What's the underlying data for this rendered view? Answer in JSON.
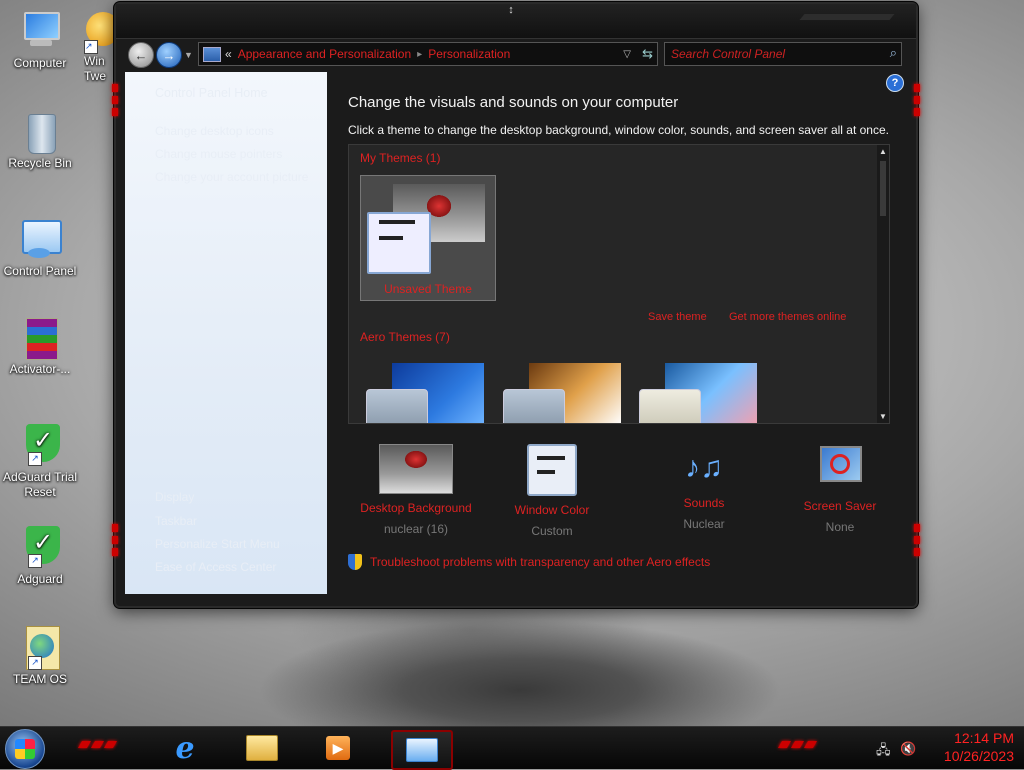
{
  "desktop": {
    "icons": [
      {
        "label": "Computer"
      },
      {
        "label": "Win Twe"
      },
      {
        "label": "Recycle Bin"
      },
      {
        "label": "Control Panel"
      },
      {
        "label": "Activator-..."
      },
      {
        "label": "AdGuard Trial Reset"
      },
      {
        "label": "Adguard"
      },
      {
        "label": "TEAM OS"
      }
    ]
  },
  "window": {
    "address": {
      "breadcrumbs": [
        "Appearance and Personalization",
        "Personalization"
      ],
      "prefix": "«"
    },
    "search": {
      "placeholder": "Search Control Panel"
    },
    "sidebar": {
      "home": "Control Panel Home",
      "links": [
        "Change desktop icons",
        "Change mouse pointers",
        "Change your account picture"
      ],
      "see_also": [
        "Display",
        "Taskbar",
        "Personalize Start Menu",
        "Ease of Access Center"
      ]
    },
    "content": {
      "title": "Change the visuals and sounds on your computer",
      "subtitle": "Click a theme to change the desktop background, window color, sounds, and screen saver all at once.",
      "my_themes_header": "My Themes (1)",
      "unsaved_theme": "Unsaved Theme",
      "save_theme": "Save theme",
      "get_more_themes": "Get more themes online",
      "aero_themes_header": "Aero Themes (7)",
      "options": [
        {
          "label": "Desktop Background",
          "value": "nuclear (16)"
        },
        {
          "label": "Window Color",
          "value": "Custom"
        },
        {
          "label": "Sounds",
          "value": "Nuclear"
        },
        {
          "label": "Screen Saver",
          "value": "None"
        }
      ],
      "troubleshoot": "Troubleshoot problems with transparency and other Aero effects"
    }
  },
  "taskbar": {
    "time": "12:14 PM",
    "date": "10/26/2023",
    "apps": [
      "internet-explorer-icon",
      "file-explorer-icon",
      "media-player-icon",
      "control-panel-icon"
    ]
  },
  "colors": {
    "accent": "#dd2222",
    "window_bg": "#1b1b1b",
    "sidebar_bg": "#e9f0f9"
  }
}
